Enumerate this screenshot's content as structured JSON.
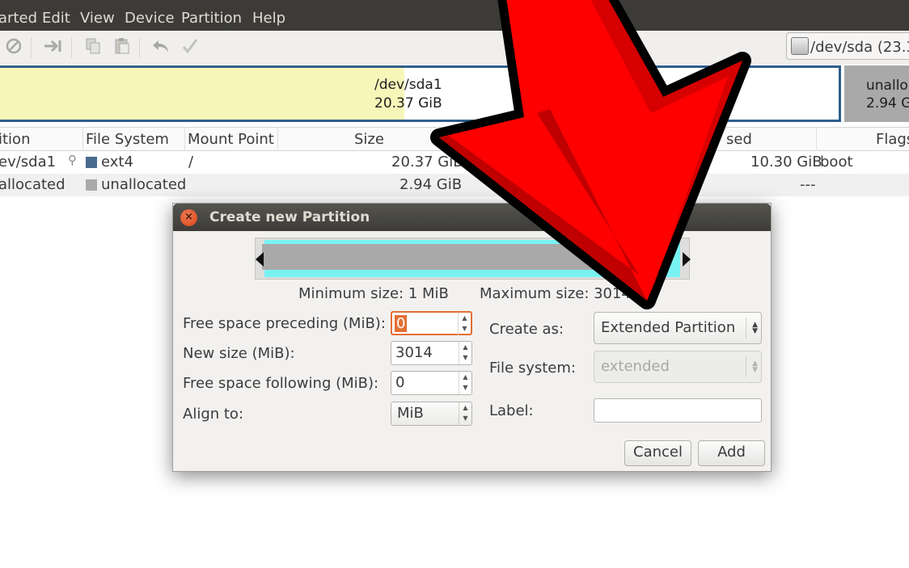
{
  "menu": [
    "arted",
    "Edit",
    "View",
    "Device",
    "Partition",
    "Help"
  ],
  "toolbar": {
    "icons": [
      "delete-icon",
      "apply-arrow-icon",
      "copy-icon",
      "paste-icon",
      "undo-icon",
      "check-icon"
    ],
    "device_selector": "/dev/sda  (23.3"
  },
  "graph": {
    "sda1_name": "/dev/sda1",
    "sda1_size": "20.37 GiB",
    "unalloc_name": "unallo",
    "unalloc_size": "2.94 Gi",
    "used_color": "#f7f6b9",
    "border_color": "#2f5e8c",
    "unalloc_color": "#a9a9a9"
  },
  "table": {
    "headers": [
      "ition",
      "File System",
      "Mount Point",
      "Size",
      "sed",
      "Flags"
    ],
    "rows": [
      {
        "partition": "ev/sda1",
        "fs": "ext4",
        "fs_color": "#4a6a8e",
        "mount": "/",
        "size": "20.37 GiB",
        "used": "10.30 GiB",
        "flags": "boot"
      },
      {
        "partition": "allocated",
        "fs": "unallocated",
        "fs_color": "#a9a9a9",
        "mount": "",
        "size": "2.94 GiB",
        "used": "---",
        "flags": ""
      }
    ]
  },
  "dialog": {
    "title": "Create new Partition",
    "min_size": "Minimum size: 1 MiB",
    "max_size": "Maximum size: 3014 M",
    "free_preceding_label": "Free space preceding (MiB):",
    "free_preceding_value": "0",
    "new_size_label": "New size (MiB):",
    "new_size_value": "3014",
    "free_following_label": "Free space following (MiB):",
    "free_following_value": "0",
    "align_label": "Align to:",
    "align_value": "MiB",
    "create_as_label": "Create as:",
    "create_as_value": "Extended Partition",
    "fs_label": "File system:",
    "fs_value": "extended",
    "label_label": "Label:",
    "label_value": "",
    "cancel": "Cancel",
    "add": "Add"
  },
  "annotation": {
    "arrow_color": "#ff0000",
    "arrow_icon": "big-red-arrow"
  }
}
